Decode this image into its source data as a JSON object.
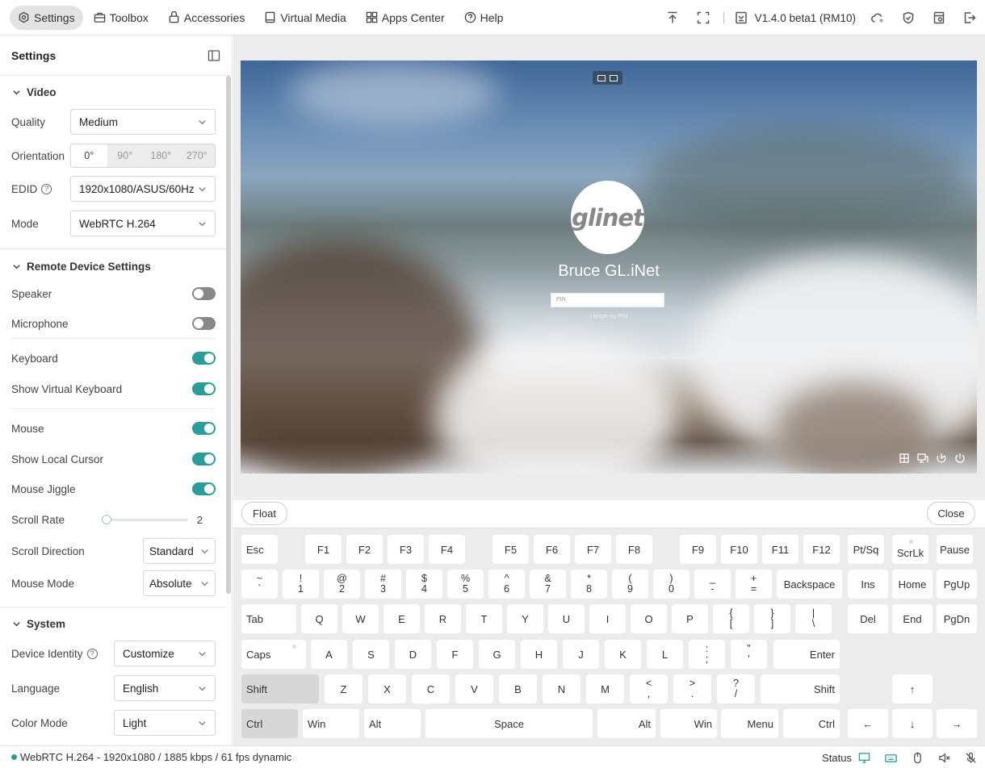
{
  "topnav": {
    "items": [
      {
        "label": "Settings",
        "icon": "settings-icon",
        "active": true
      },
      {
        "label": "Toolbox",
        "icon": "toolbox-icon"
      },
      {
        "label": "Accessories",
        "icon": "accessories-icon"
      },
      {
        "label": "Virtual Media",
        "icon": "virtual-media-icon"
      },
      {
        "label": "Apps Center",
        "icon": "apps-center-icon"
      },
      {
        "label": "Help",
        "icon": "help-icon"
      }
    ],
    "version": "V1.4.0 beta1 (RM10)"
  },
  "sidebar": {
    "title": "Settings",
    "video": {
      "title": "Video",
      "quality_label": "Quality",
      "quality_value": "Medium",
      "orientation_label": "Orientation",
      "orientation_options": [
        "0°",
        "90°",
        "180°",
        "270°"
      ],
      "edid_label": "EDID",
      "edid_value": "1920x1080/ASUS/60Hz",
      "mode_label": "Mode",
      "mode_value": "WebRTC H.264"
    },
    "remote": {
      "title": "Remote Device Settings",
      "speaker": "Speaker",
      "microphone": "Microphone",
      "keyboard": "Keyboard",
      "show_virtual_keyboard": "Show Virtual Keyboard",
      "mouse": "Mouse",
      "show_local_cursor": "Show Local Cursor",
      "mouse_jiggle": "Mouse Jiggle",
      "scroll_rate_label": "Scroll Rate",
      "scroll_rate_value": "2",
      "scroll_direction_label": "Scroll Direction",
      "scroll_direction_value": "Standard",
      "mouse_mode_label": "Mouse Mode",
      "mouse_mode_value": "Absolute"
    },
    "system": {
      "title": "System",
      "device_identity_label": "Device Identity",
      "device_identity_value": "Customize",
      "language_label": "Language",
      "language_value": "English",
      "color_mode_label": "Color Mode",
      "color_mode_value": "Light"
    }
  },
  "remote_screen": {
    "logo_text": "glinet",
    "user_name": "Bruce GL.iNet",
    "pin_placeholder": "PIN",
    "forgot_pin": "I forgot my PIN"
  },
  "keyboard": {
    "float_label": "Float",
    "close_label": "Close",
    "rows": {
      "fn": [
        "Esc",
        "F1",
        "F2",
        "F3",
        "F4",
        "F5",
        "F6",
        "F7",
        "F8",
        "F9",
        "F10",
        "F11",
        "F12",
        "Pt/Sq",
        "ScrLk",
        "Pause"
      ],
      "num": [
        [
          "~",
          "`"
        ],
        [
          "!",
          "1"
        ],
        [
          "@",
          "2"
        ],
        [
          "#",
          "3"
        ],
        [
          "$",
          "4"
        ],
        [
          "%",
          "5"
        ],
        [
          "^",
          "6"
        ],
        [
          "&",
          "7"
        ],
        [
          "*",
          "8"
        ],
        [
          "(",
          "9"
        ],
        [
          ")",
          "0"
        ],
        [
          "_",
          "-"
        ],
        [
          "+",
          "="
        ],
        "Backspace",
        "Ins",
        "Home",
        "PgUp"
      ],
      "top": [
        "Tab",
        "Q",
        "W",
        "E",
        "R",
        "T",
        "Y",
        "U",
        "I",
        "O",
        "P",
        [
          "{",
          "["
        ],
        [
          "}",
          "]"
        ],
        [
          "|",
          "\\"
        ],
        "Del",
        "End",
        "PgDn"
      ],
      "home": [
        "Caps",
        "A",
        "S",
        "D",
        "F",
        "G",
        "H",
        "J",
        "K",
        "L",
        [
          ":",
          ";"
        ],
        [
          "\"",
          "'"
        ],
        "Enter"
      ],
      "shift": [
        "Shift",
        "Z",
        "X",
        "C",
        "V",
        "B",
        "N",
        "M",
        [
          "<",
          ","
        ],
        [
          ">",
          "."
        ],
        [
          "?",
          "/"
        ],
        "Shift",
        "↑"
      ],
      "bottom": [
        "Ctrl",
        "Win",
        "Alt",
        "Space",
        "Alt",
        "Win",
        "Menu",
        "Ctrl",
        "←",
        "↓",
        "→"
      ]
    }
  },
  "statusbar": {
    "stream_info": "WebRTC H.264 - 1920x1080 / 1885 kbps / 61 fps dynamic",
    "status_label": "Status"
  },
  "colors": {
    "accent": "#2a9d9a"
  }
}
